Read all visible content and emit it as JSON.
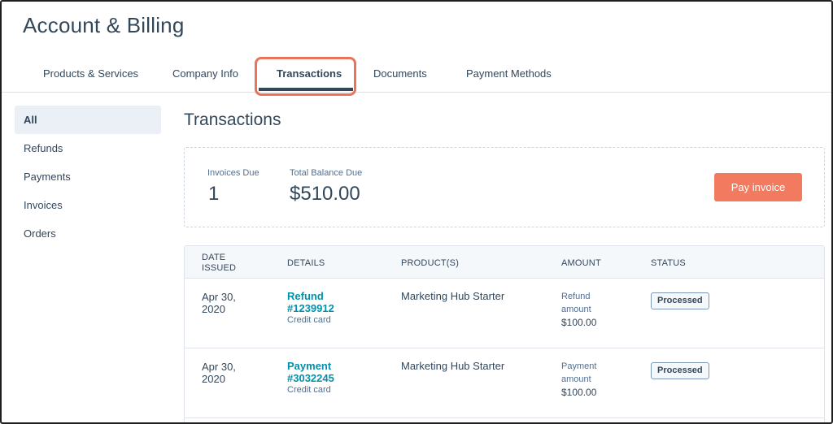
{
  "page": {
    "title": "Account & Billing"
  },
  "tabs": [
    {
      "label": "Products & Services"
    },
    {
      "label": "Company Info"
    },
    {
      "label": "Transactions"
    },
    {
      "label": "Documents"
    },
    {
      "label": "Payment Methods"
    }
  ],
  "sidebar": {
    "items": [
      {
        "label": "All"
      },
      {
        "label": "Refunds"
      },
      {
        "label": "Payments"
      },
      {
        "label": "Invoices"
      },
      {
        "label": "Orders"
      }
    ]
  },
  "main": {
    "title": "Transactions",
    "summary": {
      "invoices_due_label": "Invoices Due",
      "invoices_due_value": "1",
      "balance_label": "Total Balance Due",
      "balance_value": "$510.00",
      "pay_button": "Pay invoice"
    },
    "table": {
      "headers": {
        "date_line1": "DATE",
        "date_line2": "ISSUED",
        "details": "DETAILS",
        "product": "PRODUCT(S)",
        "amount": "AMOUNT",
        "status": "STATUS"
      },
      "rows": [
        {
          "date_line1": "Apr 30,",
          "date_line2": "2020",
          "detail_line1": "Refund",
          "detail_line2": "#1239912",
          "detail_sub": "Credit card",
          "product": "Marketing Hub Starter",
          "amount_label_1": "Refund",
          "amount_label_2": "amount",
          "amount_value": "$100.00",
          "status": "Processed"
        },
        {
          "date_line1": "Apr 30,",
          "date_line2": "2020",
          "detail_line1": "Payment",
          "detail_line2": "#3032245",
          "detail_sub": "Credit card",
          "product": "Marketing Hub Starter",
          "amount_label_1": "Payment",
          "amount_label_2": "amount",
          "amount_value": "$100.00",
          "status": "Processed"
        }
      ]
    }
  },
  "colors": {
    "accent": "#f27a5e",
    "link": "#0091ae",
    "text": "#33475b",
    "highlight": "#e8745b"
  }
}
